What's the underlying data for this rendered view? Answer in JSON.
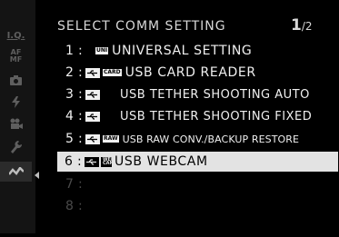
{
  "sidebar": {
    "items": [
      {
        "text": "I.Q.",
        "icon": "image-quality-icon"
      },
      {
        "text": "AF MF",
        "icon": "af-mf-icon"
      },
      {
        "text": "",
        "icon": "camera-icon"
      },
      {
        "text": "",
        "icon": "flash-icon"
      },
      {
        "text": "",
        "icon": "movie-icon"
      },
      {
        "text": "",
        "icon": "wrench-icon"
      },
      {
        "text": "",
        "icon": "connection-icon"
      }
    ],
    "active_index": 6
  },
  "header": {
    "title": "SELECT COMM SETTING",
    "page_current": "1",
    "page_total": "/2"
  },
  "options": [
    {
      "num": "1",
      "badge": "UNI",
      "usb": false,
      "label": "UNIVERSAL SETTING"
    },
    {
      "num": "2",
      "badge": "CARD",
      "usb": true,
      "label": "USB CARD READER"
    },
    {
      "num": "3",
      "badge": "",
      "usb": true,
      "label": "USB TETHER SHOOTING AUTO"
    },
    {
      "num": "4",
      "badge": "",
      "usb": true,
      "label": "USB TETHER SHOOTING FIXED"
    },
    {
      "num": "5",
      "badge": "RAW",
      "usb": true,
      "label": "USB RAW CONV./BACKUP RESTORE"
    },
    {
      "num": "6",
      "badge": "WEB CAM",
      "usb": true,
      "label": "USB WEBCAM"
    },
    {
      "num": "7",
      "badge": "",
      "usb": false,
      "label": ""
    },
    {
      "num": "8",
      "badge": "",
      "usb": false,
      "label": ""
    }
  ],
  "selected_index": 5,
  "colors": {
    "background": "#000000",
    "text": "#f0f0f0",
    "highlight": "#e3e3e3",
    "disabled": "#4a4a4a"
  }
}
